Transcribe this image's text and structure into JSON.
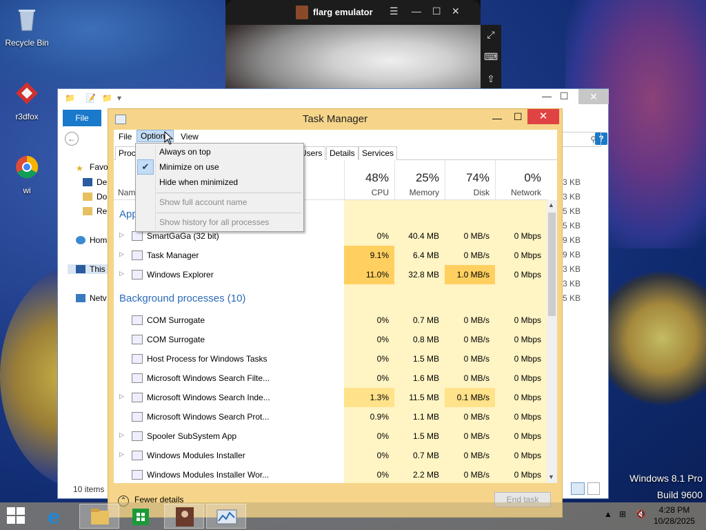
{
  "desktop": {
    "icons": [
      {
        "label": "Recycle Bin"
      },
      {
        "label": "r3dfox"
      },
      {
        "label": "wi"
      }
    ],
    "watermark": {
      "line1": "Windows 8.1 Pro",
      "line2": "Build 9600"
    }
  },
  "emulator": {
    "title": "flarg emulator"
  },
  "explorer": {
    "file_tab": "File",
    "nav_items": [
      "Favo",
      "De",
      "Do",
      "Re",
      "Hom",
      "This",
      "Netv"
    ],
    "sizes": [
      "3 KB",
      "3 KB",
      "5 KB",
      "5 KB",
      "9 KB",
      "9 KB",
      "3 KB",
      "3 KB",
      "5 KB"
    ],
    "status": "10 items"
  },
  "task_manager": {
    "title": "Task Manager",
    "menu": [
      "File",
      "Options",
      "View"
    ],
    "tabs": [
      "Proc",
      "Users",
      "Details",
      "Services"
    ],
    "columns": [
      {
        "pct": "48%",
        "label": "CPU"
      },
      {
        "pct": "25%",
        "label": "Memory"
      },
      {
        "pct": "74%",
        "label": "Disk"
      },
      {
        "pct": "0%",
        "label": "Network"
      }
    ],
    "name_header": "Nam",
    "apps_header": "App",
    "apps": [
      {
        "name": "SmartGaGa (32 bit)",
        "cpu": "0%",
        "mem": "40.4 MB",
        "disk": "0 MB/s",
        "net": "0 Mbps"
      },
      {
        "name": "Task Manager",
        "cpu": "9.1%",
        "mem": "6.4 MB",
        "disk": "0 MB/s",
        "net": "0 Mbps"
      },
      {
        "name": "Windows Explorer",
        "cpu": "11.0%",
        "mem": "32.8 MB",
        "disk": "1.0 MB/s",
        "net": "0 Mbps"
      }
    ],
    "bg_header": "Background processes (10)",
    "background": [
      {
        "name": "COM Surrogate",
        "cpu": "0%",
        "mem": "0.7 MB",
        "disk": "0 MB/s",
        "net": "0 Mbps"
      },
      {
        "name": "COM Surrogate",
        "cpu": "0%",
        "mem": "0.8 MB",
        "disk": "0 MB/s",
        "net": "0 Mbps"
      },
      {
        "name": "Host Process for Windows Tasks",
        "cpu": "0%",
        "mem": "1.5 MB",
        "disk": "0 MB/s",
        "net": "0 Mbps"
      },
      {
        "name": "Microsoft Windows Search Filte...",
        "cpu": "0%",
        "mem": "1.6 MB",
        "disk": "0 MB/s",
        "net": "0 Mbps"
      },
      {
        "name": "Microsoft Windows Search Inde...",
        "cpu": "1.3%",
        "mem": "11.5 MB",
        "disk": "0.1 MB/s",
        "net": "0 Mbps"
      },
      {
        "name": "Microsoft Windows Search Prot...",
        "cpu": "0.9%",
        "mem": "1.1 MB",
        "disk": "0 MB/s",
        "net": "0 Mbps"
      },
      {
        "name": "Spooler SubSystem App",
        "cpu": "0%",
        "mem": "1.5 MB",
        "disk": "0 MB/s",
        "net": "0 Mbps"
      },
      {
        "name": "Windows Modules Installer",
        "cpu": "0%",
        "mem": "0.7 MB",
        "disk": "0 MB/s",
        "net": "0 Mbps"
      },
      {
        "name": "Windows Modules Installer Wor...",
        "cpu": "0%",
        "mem": "2.2 MB",
        "disk": "0 MB/s",
        "net": "0 Mbps"
      }
    ],
    "fewer_details": "Fewer details",
    "end_task": "End task"
  },
  "options_menu": {
    "items": [
      {
        "label": "Always on top",
        "checked": false,
        "disabled": false
      },
      {
        "label": "Minimize on use",
        "checked": true,
        "disabled": false
      },
      {
        "label": "Hide when minimized",
        "checked": false,
        "disabled": false
      },
      {
        "label": "Show full account name",
        "checked": false,
        "disabled": true
      },
      {
        "label": "Show history for all processes",
        "checked": false,
        "disabled": true
      }
    ]
  },
  "taskbar": {
    "clock_time": "4:28 PM",
    "clock_date": "10/28/2025"
  },
  "colors": {
    "heat_light": "#fff4c4",
    "heat_mid": "#ffe28a",
    "heat_strong": "#ffd060",
    "accent": "#1979ca",
    "close_red": "#e04343"
  }
}
